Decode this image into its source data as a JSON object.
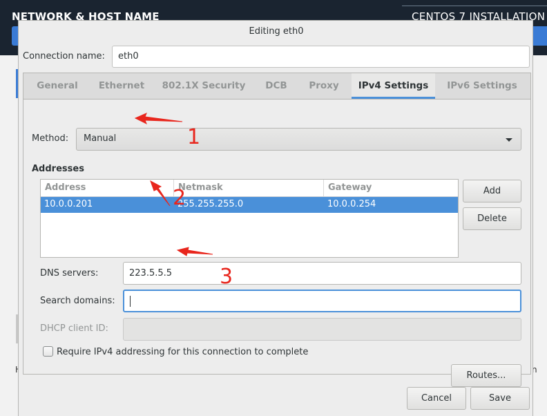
{
  "installer": {
    "left_title": "NETWORK & HOST NAME",
    "right_title": "CENTOS 7 INSTALLATION",
    "partial_left": "H",
    "partial_right": "n"
  },
  "dialog": {
    "title": "Editing eth0",
    "connection_name_label": "Connection name:",
    "connection_name_value": "eth0",
    "tabs": [
      {
        "label": "General",
        "active": false
      },
      {
        "label": "Ethernet",
        "active": false
      },
      {
        "label": "802.1X Security",
        "active": false
      },
      {
        "label": "DCB",
        "active": false
      },
      {
        "label": "Proxy",
        "active": false
      },
      {
        "label": "IPv4 Settings",
        "active": true
      },
      {
        "label": "IPv6 Settings",
        "active": false
      }
    ],
    "method_label": "Method:",
    "method_value": "Manual",
    "addresses_label": "Addresses",
    "address_table": {
      "columns": [
        "Address",
        "Netmask",
        "Gateway"
      ],
      "rows": [
        {
          "address": "10.0.0.201",
          "netmask": "255.255.255.0",
          "gateway": "10.0.0.254",
          "selected": true
        }
      ]
    },
    "add_button": "Add",
    "delete_button": "Delete",
    "dns_label": "DNS servers:",
    "dns_value": "223.5.5.5",
    "search_domains_label": "Search domains:",
    "search_domains_value": "",
    "dhcp_client_id_label": "DHCP client ID:",
    "dhcp_client_id_value": "",
    "require_ipv4_label": "Require IPv4 addressing for this connection to complete",
    "require_ipv4_checked": false,
    "routes_button": "Routes...",
    "cancel_button": "Cancel",
    "save_button": "Save"
  },
  "annotations": {
    "marker_1": "1",
    "marker_2": "2",
    "marker_3": "3",
    "color": "#e8261d"
  },
  "colors": {
    "accent": "#4a90d9",
    "header_bg": "#1a2430"
  }
}
